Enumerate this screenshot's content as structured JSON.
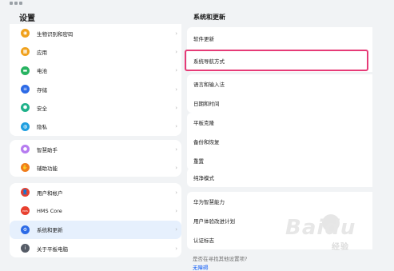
{
  "status_bar": {
    "icons": [
      "signal-icon",
      "wifi-icon",
      "battery-icon"
    ]
  },
  "left": {
    "title": "设置",
    "card1": [
      {
        "label": "生物识别和密码",
        "icon": "fingerprint-icon",
        "color": "#f0a11c",
        "glyph": "◉"
      },
      {
        "label": "应用",
        "icon": "apps-icon",
        "color": "#f0a11c",
        "glyph": "▦"
      },
      {
        "label": "电池",
        "icon": "battery-icon",
        "color": "#27b361",
        "glyph": "▬"
      },
      {
        "label": "存储",
        "icon": "storage-icon",
        "color": "#2c6ae6",
        "glyph": "≡"
      },
      {
        "label": "安全",
        "icon": "shield-icon",
        "color": "#1fb18a",
        "glyph": "⬢"
      },
      {
        "label": "隐私",
        "icon": "privacy-icon",
        "color": "#1f9fe0",
        "glyph": "◍"
      }
    ],
    "card2": [
      {
        "label": "智慧助手",
        "icon": "assistant-icon",
        "color": "#b67cf0",
        "glyph": "●"
      },
      {
        "label": "辅助功能",
        "icon": "accessibility-icon",
        "color": "#f07d1c",
        "glyph": "✋"
      }
    ],
    "card3": [
      {
        "label": "用户和帐户",
        "icon": "user-icon",
        "color": "#e8402f",
        "glyph": "👤"
      },
      {
        "label": "HMS Core",
        "icon": "hms-core-icon",
        "color": "#e8402f",
        "glyph": "HMS"
      },
      {
        "label": "系统和更新",
        "icon": "system-update-icon",
        "color": "#2c6ae6",
        "glyph": "⚙",
        "selected": true
      },
      {
        "label": "关于平板电脑",
        "icon": "about-icon",
        "color": "#555b66",
        "glyph": "i"
      }
    ]
  },
  "right": {
    "title": "系统和更新",
    "group1": [
      "软件更新",
      "系统导航方式"
    ],
    "group2": [
      "语言和输入法",
      "日期和时间"
    ],
    "group3": [
      "平板克隆",
      "备份和恢复",
      "重置"
    ],
    "group4": [
      "纯净模式"
    ],
    "group5": [
      "华为智慧能力",
      "用户体验改进计划",
      "认证标志"
    ],
    "footer_question": "是否在寻找其他设置项?",
    "footer_link": "无障碍"
  },
  "highlight_color": "#e63b77",
  "watermark": {
    "text": "Baidu",
    "sub": "经验"
  }
}
